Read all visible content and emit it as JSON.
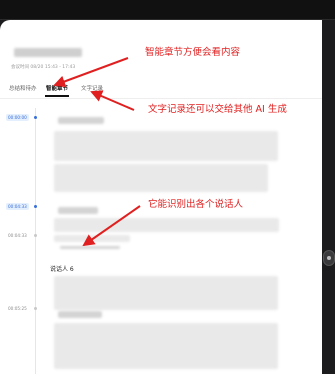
{
  "tabs": [
    {
      "label": "总结和待办"
    },
    {
      "label": "智能章节"
    },
    {
      "label": "文字记录"
    }
  ],
  "meta_text": "会议时间 08/20 15:43 - 17:43",
  "timestamps": [
    "00:00:00",
    "00:04:33",
    "00:04:33",
    "00:05:25"
  ],
  "speaker_label": "说话人 6",
  "annotations": {
    "chapters": "智能章节方便会看内容",
    "transcript": "文字记录还可以交给其他 AI 生成",
    "speakers": "它能识别出各个说话人"
  },
  "colors": {
    "annotation": "#e02020",
    "accent": "#3a6fd8"
  }
}
